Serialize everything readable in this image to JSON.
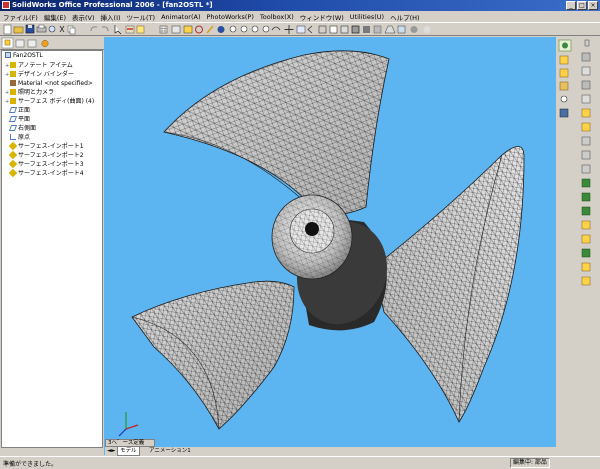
{
  "window": {
    "title": "SolidWorks Office Professional 2006 - [fan2OSTL *]",
    "min_label": "_",
    "max_label": "□",
    "close_label": "×"
  },
  "menu": [
    "ファイル(F)",
    "編集(E)",
    "表示(V)",
    "挿入(I)",
    "ツール(T)",
    "Animator(A)",
    "PhotoWorks(P)",
    "Toolbox(X)",
    "ウィンドウ(W)",
    "Utilities(U)",
    "ヘルプ(H)"
  ],
  "tree": {
    "root": "Fan2OSTL",
    "items": [
      {
        "label": "アノテート アイテム",
        "icon": "annotation-icon",
        "color": "#d8b300"
      },
      {
        "label": "デザイン バインダー",
        "icon": "design-binder-icon",
        "color": "#d8b300"
      },
      {
        "label": "Material <not specified>",
        "icon": "material-icon",
        "color": "#9a6b3a"
      },
      {
        "label": "照明と力メラ",
        "icon": "lights-camera-icon",
        "color": "#d8b300"
      },
      {
        "label": "サーフェス ボディ(曲面) (4)",
        "icon": "surface-body-icon",
        "color": "#d8b300"
      },
      {
        "label": "正面",
        "icon": "plane-icon",
        "color": "#4a7fc0"
      },
      {
        "label": "平面",
        "icon": "plane-icon",
        "color": "#4a7fc0"
      },
      {
        "label": "右側面",
        "icon": "plane-icon",
        "color": "#4a7fc0"
      },
      {
        "label": "原点",
        "icon": "origin-icon",
        "color": "#4a7fc0"
      },
      {
        "label": "サーフェス-インポート1",
        "icon": "surface-import-icon",
        "color": "#d8b300"
      },
      {
        "label": "サーフェス-インポート2",
        "icon": "surface-import-icon",
        "color": "#d8b300"
      },
      {
        "label": "サーフェス-インポート3",
        "icon": "surface-import-icon",
        "color": "#d8b300"
      },
      {
        "label": "サーフェス-インポート4",
        "icon": "surface-import-icon",
        "color": "#d8b300"
      }
    ]
  },
  "viewport": {
    "background": "#5cb4f0",
    "model": "fan-propeller-mesh"
  },
  "tabstrip_label": "3ヘ゛ース定義",
  "bottom_tabs": [
    "モデル",
    "アニメーション1"
  ],
  "status": {
    "left": "準備ができました。",
    "right": "編集中: 部品"
  }
}
